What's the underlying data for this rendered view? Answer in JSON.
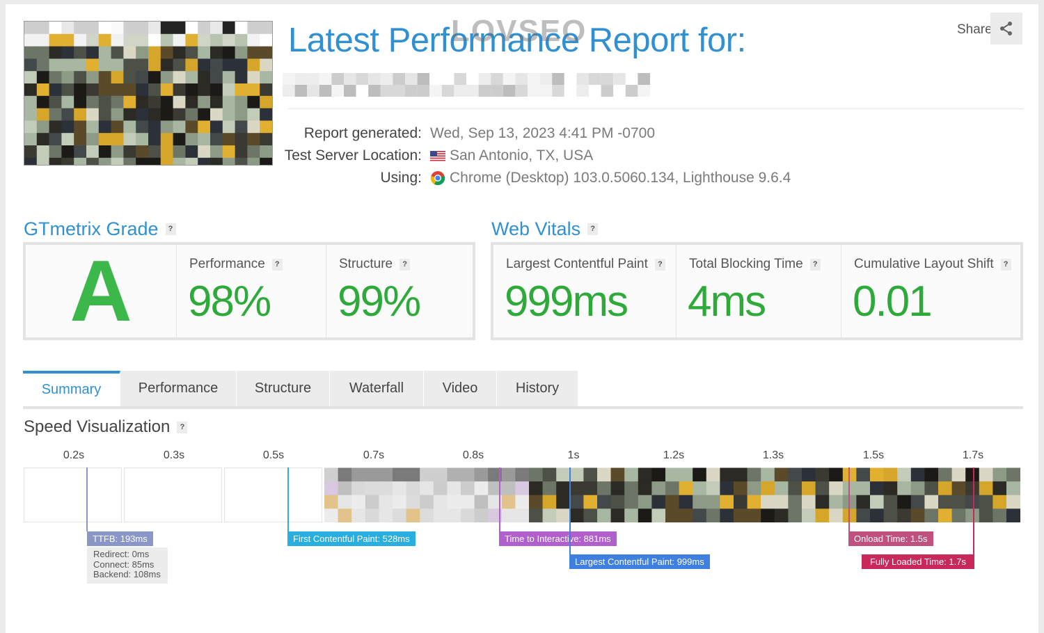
{
  "header": {
    "title": "Latest Performance Report for:",
    "watermark": "LOVSEO",
    "share_label": "Share",
    "share_icon": "share-icon"
  },
  "report_info": {
    "generated_label": "Report generated:",
    "generated_value": "Wed, Sep 13, 2023 4:41 PM -0700",
    "location_label": "Test Server Location:",
    "location_value": "San Antonio, TX, USA",
    "using_label": "Using:",
    "using_value": "Chrome (Desktop) 103.0.5060.134, Lighthouse 9.6.4"
  },
  "gtmetrix": {
    "title": "GTmetrix Grade",
    "help": "?",
    "grade": "A",
    "performance_label": "Performance",
    "performance_value": "98%",
    "structure_label": "Structure",
    "structure_value": "99%"
  },
  "web_vitals": {
    "title": "Web Vitals",
    "help": "?",
    "lcp_label": "Largest Contentful Paint",
    "lcp_value": "999ms",
    "tbt_label": "Total Blocking Time",
    "tbt_value": "4ms",
    "cls_label": "Cumulative Layout Shift",
    "cls_value": "0.01"
  },
  "tabs": [
    "Summary",
    "Performance",
    "Structure",
    "Waterfall",
    "Video",
    "History"
  ],
  "active_tab": "Summary",
  "speed": {
    "title": "Speed Visualization",
    "help": "?",
    "ticks": [
      "0.2s",
      "0.3s",
      "0.5s",
      "0.7s",
      "0.8s",
      "1s",
      "1.2s",
      "1.3s",
      "1.5s",
      "1.7s"
    ],
    "markers": {
      "ttfb": "TTFB: 193ms",
      "fcp": "First Contentful Paint: 528ms",
      "tti": "Time to Interactive: 881ms",
      "lcp": "Largest Contentful Paint: 999ms",
      "onload": "Onload Time: 1.5s",
      "fully": "Fully Loaded Time: 1.7s"
    },
    "ttfb_details": {
      "redirect": "Redirect: 0ms",
      "connect": "Connect: 85ms",
      "backend": "Backend: 108ms"
    }
  },
  "colors": {
    "accent": "#3090d0",
    "grade_green": "#2eaa3a",
    "ttfb": "#8a96c8",
    "fcp": "#29aee0",
    "tti": "#b15fcc",
    "lcp": "#3f7fe0",
    "onload": "#c0507e",
    "fully": "#c8285a"
  }
}
